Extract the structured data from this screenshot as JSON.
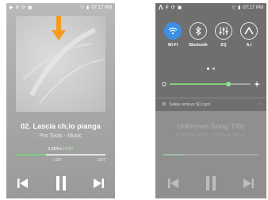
{
  "left_screen": {
    "status": {
      "time": "07:17 PM",
      "left_icons": [
        "play-icon",
        "usb-icon",
        "sync-icon",
        "image-icon"
      ],
      "right_icons": [
        "wifi-icon",
        "battery-icon"
      ]
    },
    "now_playing": {
      "title": "02. Lascia ch;io pianga",
      "subtitle": "Pro Tools - Music",
      "quality_rate": "5.6MHz",
      "quality_sep": "/",
      "quality_bits": "DSD",
      "elapsed": "1:20",
      "total": "3:57",
      "progress_fraction": 0.34
    },
    "annotation": {
      "arrow_color": "#f39c1f"
    },
    "controls": [
      "previous-icon",
      "pause-icon",
      "next-icon"
    ]
  },
  "right_screen": {
    "status": {
      "time": "07:17 PM",
      "left_icons": [
        "ak-logo-icon",
        "usb-icon",
        "sync-icon",
        "image-icon"
      ],
      "right_icons": [
        "wifi-icon",
        "battery-icon"
      ]
    },
    "quick_toggles": [
      {
        "label": "Wi-Fi",
        "icon": "wifi-icon",
        "active": true
      },
      {
        "label": "Bluetooth",
        "icon": "bluetooth-icon",
        "active": false
      },
      {
        "label": "EQ",
        "icon": "equalizer-icon",
        "active": false
      },
      {
        "label": "A.I",
        "icon": "ai-logo-icon",
        "active": false
      }
    ],
    "brightness_fraction": 0.73,
    "notification": "Safely remove SD card",
    "dimmed_track": {
      "title": "Unknown Song Title",
      "subtitle": "Unknown artist - Unknown album",
      "progress_fraction": 0.2
    }
  },
  "colors": {
    "accent_blue": "#3d8fe6",
    "accent_green": "#7fd07f",
    "arrow_orange": "#f39c1f"
  }
}
